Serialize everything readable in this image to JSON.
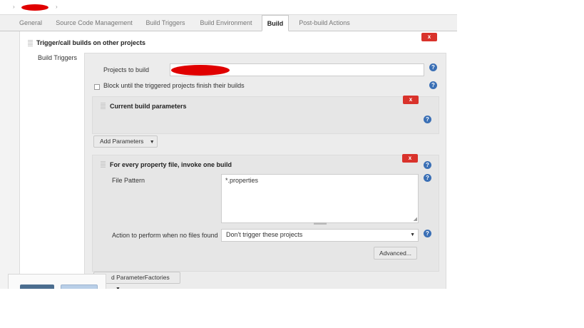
{
  "breadcrumb": {
    "sep1": "›",
    "sep2": "›"
  },
  "tabs": [
    {
      "label": "General"
    },
    {
      "label": "Source Code Management"
    },
    {
      "label": "Build Triggers"
    },
    {
      "label": "Build Environment"
    },
    {
      "label": "Build"
    },
    {
      "label": "Post-build Actions"
    }
  ],
  "sidebar": {
    "label": "Build Triggers"
  },
  "step": {
    "title": "Trigger/call builds on other projects",
    "delete_label": "x",
    "projects_label": "Projects to build",
    "block_label": "Block until the triggered projects finish their builds",
    "current_params": {
      "title": "Current build parameters",
      "delete_label": "x"
    },
    "add_parameters": "Add Parameters",
    "property_file": {
      "title": "For every property file, invoke one build",
      "delete_label": "x",
      "file_pattern_label": "File Pattern",
      "file_pattern_value": "*.properties",
      "action_label": "Action to perform when no files found",
      "action_value": "Don't trigger these projects",
      "advanced": "Advanced..."
    },
    "add_factories": "d ParameterFactories"
  },
  "help_glyph": "?",
  "colors": {
    "delete": "#d9322b",
    "help": "#3a6fb5",
    "redaction": "#e00000"
  }
}
